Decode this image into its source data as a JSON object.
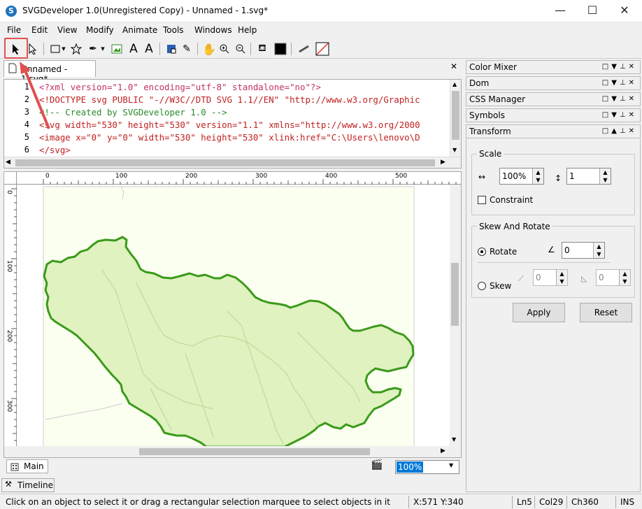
{
  "title": {
    "app_icon": "S",
    "text": "SVGDeveloper 1.0(Unregistered Copy) - Unnamed - 1.svg*"
  },
  "window": {
    "minimize": "—",
    "maximize": "☐",
    "close": "✕"
  },
  "menu": [
    "File",
    "Edit",
    "View",
    "Modify",
    "Animate",
    "Tools",
    "Windows",
    "Help"
  ],
  "toolbar": {
    "stroke_width": "1"
  },
  "editor": {
    "tab": "Unnamed - 1.svg*",
    "lines": [
      {
        "n": "1",
        "text": "<?xml version=\"1.0\" encoding=\"utf-8\" standalone=\"no\"?>"
      },
      {
        "n": "2",
        "text": "<!DOCTYPE svg PUBLIC \"-//W3C//DTD SVG 1.1//EN\" \"http://www.w3.org/Graphic"
      },
      {
        "n": "3",
        "text": "<!-- Created by SVGDeveloper 1.0 -->"
      },
      {
        "n": "4",
        "text": "<svg width=\"530\" height=\"530\" version=\"1.1\" xmlns=\"http://www.w3.org/2000"
      },
      {
        "n": "5",
        "text": "<image x=\"0\" y=\"0\" width=\"530\" height=\"530\" xlink:href=\"C:\\Users\\lenovo\\D"
      },
      {
        "n": "6",
        "text": "</svg>"
      }
    ]
  },
  "ruler": {
    "h": [
      "0",
      "100",
      "200",
      "300",
      "400",
      "500"
    ],
    "v": [
      "0",
      "100",
      "200",
      "300"
    ]
  },
  "canvas": {
    "bottom_tab": "Main",
    "zoom": "100%"
  },
  "panels": [
    "Color Mixer",
    "Dom",
    "CSS Manager",
    "Symbols",
    "Transform"
  ],
  "transform": {
    "scale_label": "Scale",
    "scale_x": "100%",
    "scale_y": "1",
    "constraint": "Constraint",
    "skew_rotate_label": "Skew And Rotate",
    "rotate_label": "Rotate",
    "rotate_value": "0",
    "skew_label": "Skew",
    "skew_x": "0",
    "skew_y": "0",
    "apply": "Apply",
    "reset": "Reset"
  },
  "timeline": "Timeline",
  "status": {
    "message": "Click on an object to select it or drag a rectangular selection marquee to select objects in it",
    "coords": "X:571  Y:340",
    "line": "Ln5",
    "col": "Col29",
    "ch": "Ch360",
    "mode": "INS"
  },
  "colors": {
    "map_fill": "#dff2bf",
    "map_stroke": "#3a9a1a",
    "paper": "#fbfff0",
    "highlight": "#e05050"
  }
}
